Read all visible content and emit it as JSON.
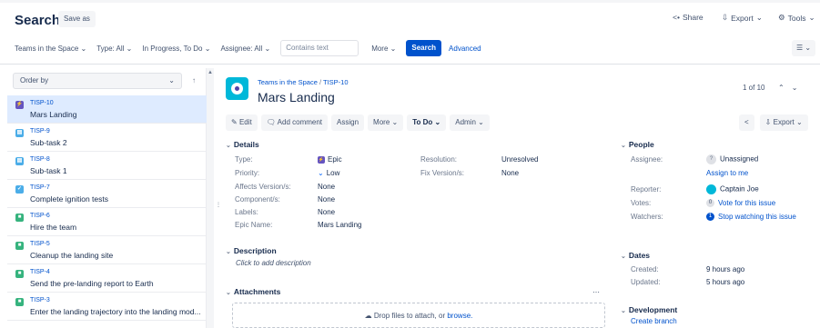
{
  "header": {
    "title": "Search",
    "save_as": "Save as",
    "share": "Share",
    "export": "Export",
    "tools": "Tools"
  },
  "filters": {
    "project": "Teams in the Space",
    "type": "Type: All",
    "status": "In Progress, To Do",
    "assignee": "Assignee: All",
    "contains_placeholder": "Contains text",
    "more": "More",
    "search": "Search",
    "advanced": "Advanced"
  },
  "order_by": "Order by",
  "issues": [
    {
      "key": "TISP-10",
      "summary": "Mars Landing",
      "type": "epic",
      "icon": "epic-icon",
      "selected": true
    },
    {
      "key": "TISP-9",
      "summary": "Sub-task 2",
      "type": "subtask",
      "icon": "subtask-icon"
    },
    {
      "key": "TISP-8",
      "summary": "Sub-task 1",
      "type": "subtask",
      "icon": "subtask-icon"
    },
    {
      "key": "TISP-7",
      "summary": "Complete ignition tests",
      "type": "task",
      "icon": "task-icon"
    },
    {
      "key": "TISP-6",
      "summary": "Hire the team",
      "type": "story",
      "icon": "story-icon"
    },
    {
      "key": "TISP-5",
      "summary": "Cleanup the landing site",
      "type": "story",
      "icon": "story-icon"
    },
    {
      "key": "TISP-4",
      "summary": "Send the pre-landing report to Earth",
      "type": "story",
      "icon": "story-icon"
    },
    {
      "key": "TISP-3",
      "summary": "Enter the landing trajectory into the landing mod...",
      "type": "story",
      "icon": "story-icon"
    }
  ],
  "issue": {
    "project": "Teams in the Space",
    "key": "TISP-10",
    "title": "Mars Landing",
    "pager": "1 of 10",
    "ops": {
      "edit": "Edit",
      "add_comment": "Add comment",
      "assign": "Assign",
      "more": "More",
      "todo": "To Do",
      "admin": "Admin",
      "export": "Export"
    },
    "details": {
      "heading": "Details",
      "type_label": "Type:",
      "type_value": "Epic",
      "priority_label": "Priority:",
      "priority_value": "Low",
      "affects_label": "Affects Version/s:",
      "affects_value": "None",
      "component_label": "Component/s:",
      "component_value": "None",
      "labels_label": "Labels:",
      "labels_value": "None",
      "epic_name_label": "Epic Name:",
      "epic_name_value": "Mars Landing",
      "resolution_label": "Resolution:",
      "resolution_value": "Unresolved",
      "fix_label": "Fix Version/s:",
      "fix_value": "None"
    },
    "description": {
      "heading": "Description",
      "placeholder": "Click to add description"
    },
    "attachments": {
      "heading": "Attachments",
      "drop_text": "Drop files to attach, or",
      "browse": "browse."
    },
    "people": {
      "heading": "People",
      "assignee_label": "Assignee:",
      "assignee_value": "Unassigned",
      "assign_to_me": "Assign to me",
      "reporter_label": "Reporter:",
      "reporter_value": "Captain Joe",
      "votes_label": "Votes:",
      "votes_count": "0",
      "votes_link": "Vote for this issue",
      "watchers_label": "Watchers:",
      "watchers_count": "1",
      "watchers_link": "Stop watching this issue"
    },
    "dates": {
      "heading": "Dates",
      "created_label": "Created:",
      "created_value": "9 hours ago",
      "updated_label": "Updated:",
      "updated_value": "5 hours ago"
    },
    "development": {
      "heading": "Development",
      "create_branch": "Create branch"
    }
  },
  "colors": {
    "accent": "#0052cc",
    "selected_row": "#deebff",
    "epic": "#6554c0",
    "story": "#36b37e",
    "subtask": "#4bade8"
  }
}
